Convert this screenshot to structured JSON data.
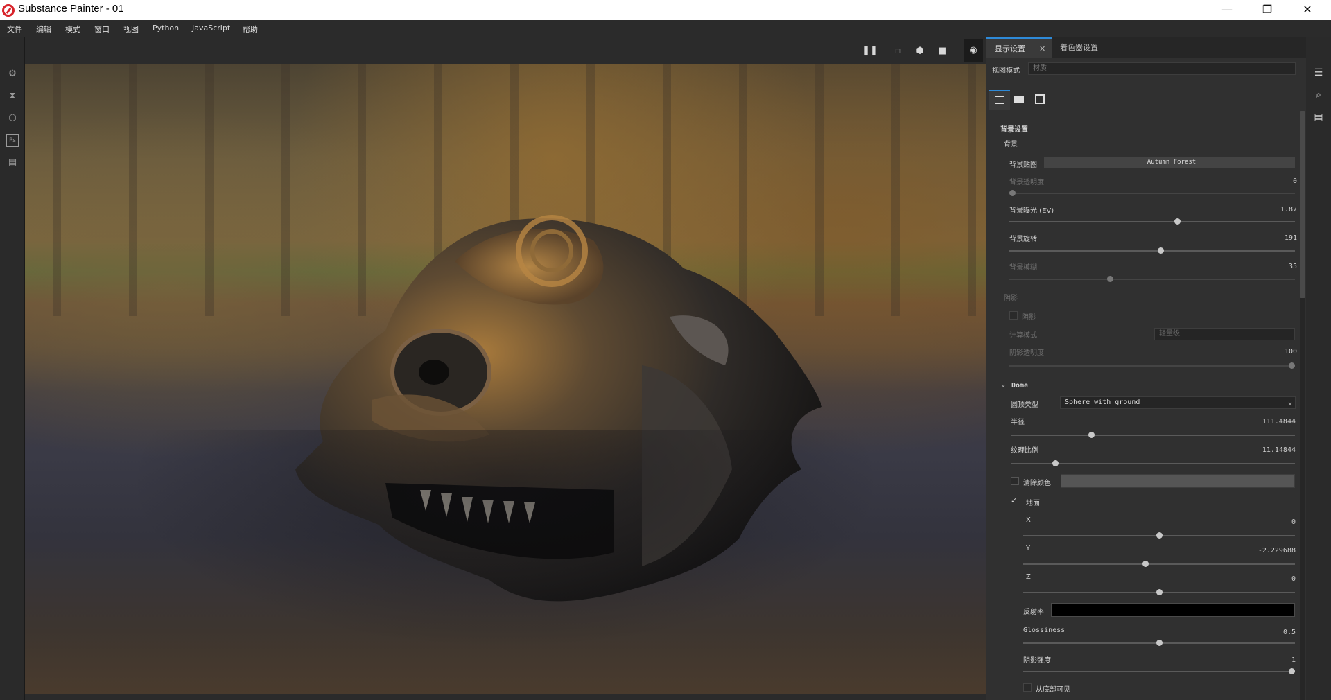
{
  "window": {
    "title": "Substance Painter - 01",
    "minimize": "—",
    "restore": "❐",
    "close": "✕"
  },
  "menu": [
    "文件",
    "编辑",
    "模式",
    "窗口",
    "视图",
    "Python",
    "JavaScript",
    "帮助"
  ],
  "left_tools": [
    "settings-icon",
    "hourglass-icon",
    "cube-icon",
    "photoshop-icon",
    "document-icon"
  ],
  "right_tools": [
    "layers-icon",
    "zoom-icon",
    "properties-icon"
  ],
  "viewport_toolbar": {
    "pause": "❚❚",
    "uv": "▫",
    "cube": "⬢",
    "camera": "■",
    "snapshot": "◉"
  },
  "panel": {
    "tabs": {
      "display": "显示设置",
      "shader": "着色器设置",
      "close": "✕"
    },
    "view_mode_label": "视图模式",
    "view_mode_value": "材质",
    "background": {
      "section_title": "背景设置",
      "sub_title": "背景",
      "map_label": "背景贴图",
      "map_value": "Autumn Forest",
      "opacity_label": "背景透明度",
      "opacity_value": "0",
      "opacity_level": 0.0,
      "exposure_label": "背景曝光 (EV)",
      "exposure_value": "1.87",
      "exposure_level": 0.59,
      "rotation_label": "背景旋转",
      "rotation_value": "191",
      "rotation_level": 0.53,
      "blur_label": "背景模糊",
      "blur_value": "35",
      "blur_level": 0.35
    },
    "shadow": {
      "title": "阴影",
      "enable_label": "阴影",
      "mode_label": "计算模式",
      "mode_value": "轻量级",
      "opacity_label": "阴影透明度",
      "opacity_value": "100",
      "opacity_level": 1.0
    },
    "dome": {
      "title": "Dome",
      "type_label": "圆顶类型",
      "type_value": "Sphere with ground",
      "radius_label": "半径",
      "radius_value": "111.4844",
      "radius_level": 0.28,
      "tex_label": "纹理比例",
      "tex_value": "11.14844",
      "tex_level": 0.15,
      "clear_label": "清除颜色",
      "ground_label": "地面",
      "x_label": "X",
      "x_value": "0",
      "x_level": 0.5,
      "y_label": "Y",
      "y_value": "-2.229688",
      "y_level": 0.45,
      "z_label": "Z",
      "z_value": "0",
      "z_level": 0.5,
      "refl_label": "反射率",
      "gloss_label": "Glossiness",
      "gloss_value": "0.5",
      "gloss_level": 0.5,
      "shadow_int_label": "阴影强度",
      "shadow_int_value": "1",
      "shadow_int_level": 1.0,
      "bottom_label": "从底部可见"
    }
  },
  "colors": {
    "accent": "#2e8ad8",
    "logo": "#d8232a",
    "panel_bg": "#303030"
  }
}
